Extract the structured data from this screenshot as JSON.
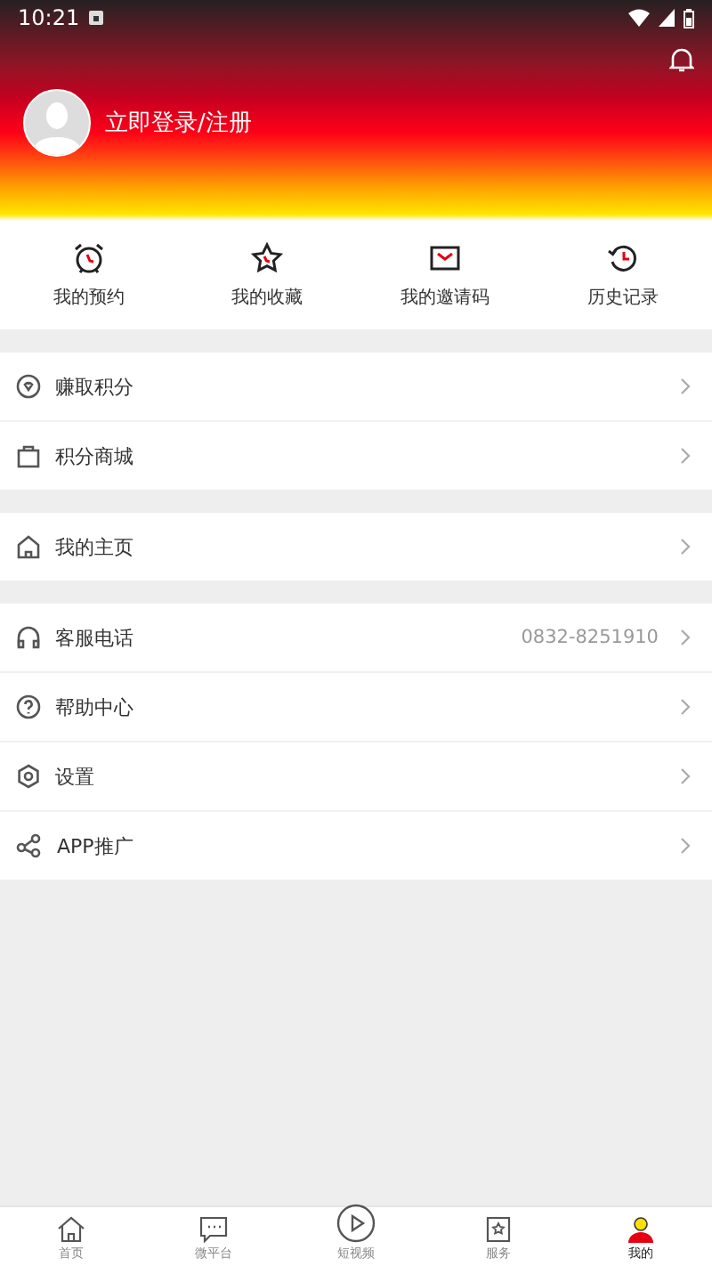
{
  "status_bar": {
    "time": "10:21"
  },
  "profile": {
    "login_label": "立即登录/注册"
  },
  "quick_actions": [
    {
      "kind": "alarm",
      "label": "我的预约"
    },
    {
      "kind": "star",
      "label": "我的收藏"
    },
    {
      "kind": "mail",
      "label": "我的邀请码"
    },
    {
      "kind": "history",
      "label": "历史记录"
    }
  ],
  "menu_groups": [
    [
      {
        "kind": "points",
        "label": "赚取积分"
      },
      {
        "kind": "bag",
        "label": "积分商城"
      }
    ],
    [
      {
        "kind": "home",
        "label": "我的主页"
      }
    ],
    [
      {
        "kind": "headset",
        "label": "客服电话",
        "value": "0832-8251910"
      },
      {
        "kind": "help",
        "label": "帮助中心"
      },
      {
        "kind": "settings",
        "label": "设置"
      },
      {
        "kind": "share",
        "label": "APP推广"
      }
    ]
  ],
  "bottom_nav": [
    {
      "kind": "home",
      "label": "首页",
      "selected": false
    },
    {
      "kind": "chat",
      "label": "微平台",
      "selected": false
    },
    {
      "kind": "play",
      "label": "短视频",
      "selected": false
    },
    {
      "kind": "service",
      "label": "服务",
      "selected": false
    },
    {
      "kind": "user",
      "label": "我的",
      "selected": true
    }
  ]
}
